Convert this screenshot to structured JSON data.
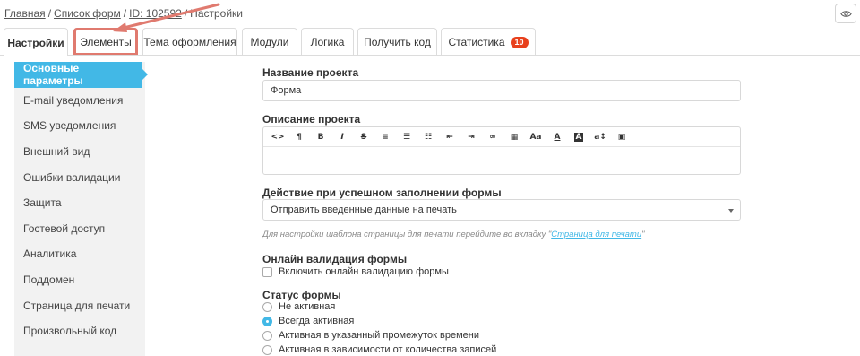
{
  "breadcrumb": {
    "home": "Главная",
    "forms": "Список форм",
    "id": "ID: 102592",
    "current": "Настройки"
  },
  "tabs": [
    {
      "label": "Настройки",
      "active": true
    },
    {
      "label": "Элементы",
      "highlighted": true
    },
    {
      "label": "Тема оформления"
    },
    {
      "label": "Модули"
    },
    {
      "label": "Логика"
    },
    {
      "label": "Получить код"
    },
    {
      "label": "Статистика",
      "badge": "10"
    }
  ],
  "sidebar": {
    "items": [
      {
        "label": "Основные параметры",
        "active": true
      },
      {
        "label": "E-mail уведомления"
      },
      {
        "label": "SMS уведомления"
      },
      {
        "label": "Внешний вид"
      },
      {
        "label": "Ошибки валидации"
      },
      {
        "label": "Защита"
      },
      {
        "label": "Гостевой доступ"
      },
      {
        "label": "Аналитика"
      },
      {
        "label": "Поддомен"
      },
      {
        "label": "Страница для печати"
      },
      {
        "label": "Произвольный код"
      }
    ]
  },
  "main": {
    "project_name": {
      "label": "Название проекта",
      "value": "Форма"
    },
    "project_description": {
      "label": "Описание проекта",
      "toolbar": [
        "code-icon",
        "paragraph-icon",
        "bold-icon",
        "italic-icon",
        "strikethrough-icon",
        "align-left-icon",
        "bullet-list-icon",
        "numbered-list-icon",
        "outdent-icon",
        "indent-icon",
        "link-icon",
        "table-icon",
        "font-size-icon",
        "font-color-icon",
        "background-color-icon",
        "line-height-icon",
        "image-icon"
      ]
    },
    "success_action": {
      "label": "Действие при успешном заполнении формы",
      "value": "Отправить введенные данные на печать",
      "hint_prefix": "Для настройки шаблона страницы для печати перейдите во вкладку \"",
      "hint_link": "Страница для печати",
      "hint_suffix": "\""
    },
    "online_validation": {
      "label": "Онлайн валидация формы",
      "checkbox_label": "Включить онлайн валидацию формы",
      "checked": false
    },
    "form_status": {
      "label": "Статус формы",
      "options": [
        {
          "label": "Не активная",
          "checked": false
        },
        {
          "label": "Всегда активная",
          "checked": true
        },
        {
          "label": "Активная в указанный промежуток времени",
          "checked": false
        },
        {
          "label": "Активная в зависимости от количества записей",
          "checked": false
        }
      ]
    }
  },
  "colors": {
    "accent": "#42b8e6",
    "highlight": "#e07a6f",
    "badge": "#e8401c"
  }
}
